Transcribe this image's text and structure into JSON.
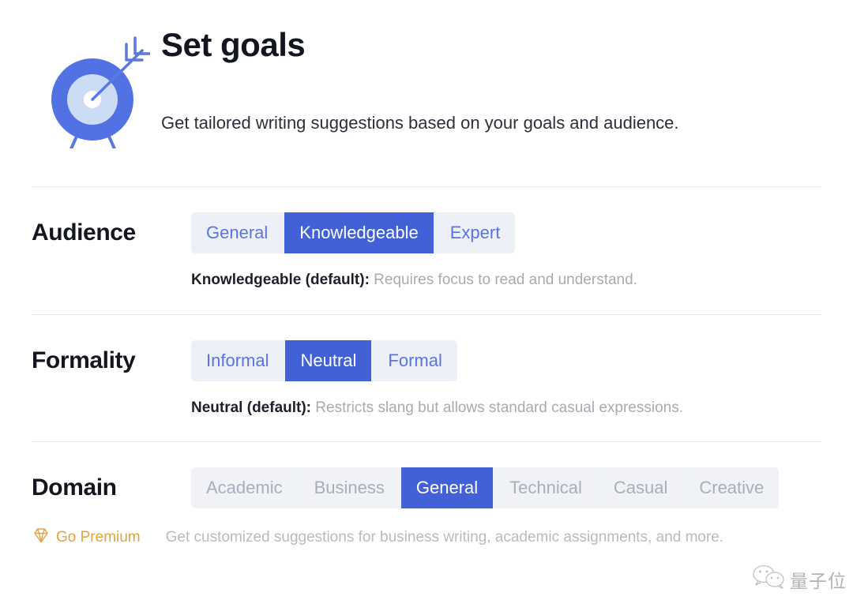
{
  "header": {
    "icon": "target-with-arrow-icon",
    "title": "Set goals",
    "subtitle": "Get tailored writing suggestions based on your goals and audience."
  },
  "colors": {
    "accent_blue": "#4361d6",
    "segment_bg": "#eef0f7",
    "segment_text": "#5a73e2",
    "muted_text": "#a8aebc",
    "premium_gold": "#e5a23f",
    "title": "#14161f",
    "divider": "#e7e9f0"
  },
  "sections": [
    {
      "label": "Audience",
      "options": [
        "General",
        "Knowledgeable",
        "Expert"
      ],
      "selected": "Knowledgeable",
      "muted": false,
      "description_strong": "Knowledgeable (default):",
      "description_rest": " Requires focus to read and understand."
    },
    {
      "label": "Formality",
      "options": [
        "Informal",
        "Neutral",
        "Formal"
      ],
      "selected": "Neutral",
      "muted": false,
      "description_strong": "Neutral (default):",
      "description_rest": " Restricts slang but allows standard casual expressions."
    },
    {
      "label": "Domain",
      "options": [
        "Academic",
        "Business",
        "General",
        "Technical",
        "Casual",
        "Creative"
      ],
      "selected": "General",
      "muted": true,
      "premium_label": "Go Premium",
      "premium_icon": "diamond-icon",
      "description_rest": "Get customized suggestions for business writing, academic assignments, and more."
    }
  ],
  "watermark": {
    "icon": "wechat-icon",
    "text": "量子位"
  }
}
